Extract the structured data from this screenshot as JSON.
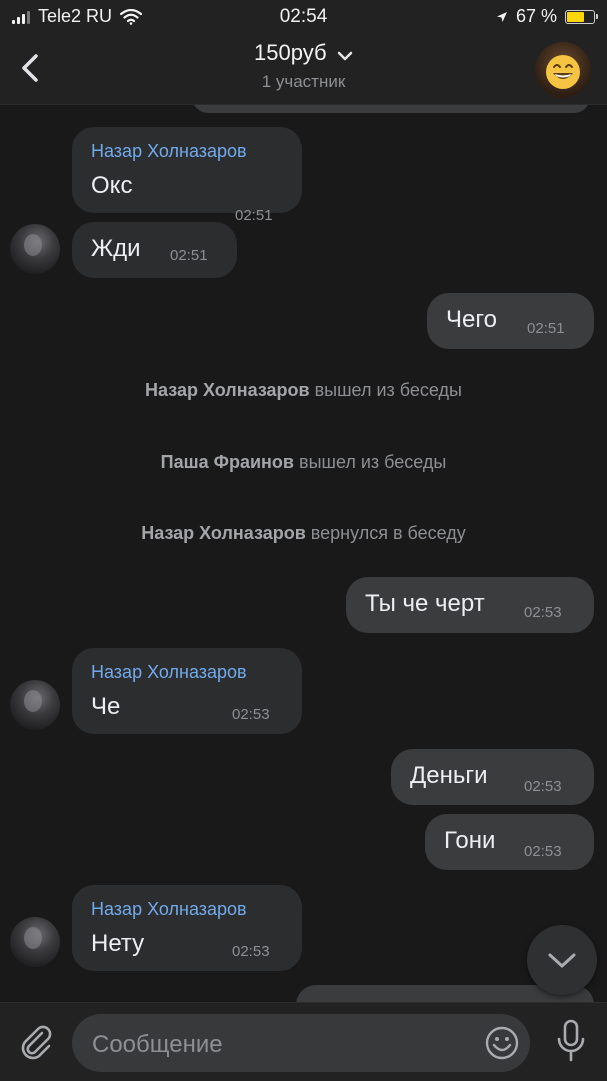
{
  "status_bar": {
    "carrier": "Tele2 RU",
    "time": "02:54",
    "battery_percent": "67 %",
    "battery_level": 0.67,
    "icons": [
      "signal-icon",
      "wifi-icon",
      "location-arrow-icon",
      "battery-icon"
    ]
  },
  "header": {
    "title": "150руб",
    "subtitle": "1 участник"
  },
  "messages": [
    {
      "sender": "Назар Холназаров",
      "text": "Окс",
      "time": "02:51"
    },
    {
      "text": "Жди",
      "time": "02:51"
    },
    {
      "text": "Чего",
      "time": "02:51"
    },
    {
      "text": "Ты че черт",
      "time": "02:53"
    },
    {
      "sender": "Назар Холназаров",
      "text": "Че",
      "time": "02:53"
    },
    {
      "text": "Деньги",
      "time": "02:53"
    },
    {
      "text": "Гони",
      "time": "02:53"
    },
    {
      "sender": "Назар Холназаров",
      "text": "Нету",
      "time": "02:53"
    }
  ],
  "service_messages": [
    {
      "name": "Назар Холназаров",
      "action": " вышел из беседы"
    },
    {
      "name": "Паша Фраинов",
      "action": " вышел из беседы"
    },
    {
      "name": "Назар Холназаров",
      "action": " вернулся в беседу"
    }
  ],
  "composer": {
    "placeholder": "Сообщение"
  },
  "colors": {
    "background": "#19191a",
    "incoming_bubble": "#2c2d2f",
    "outgoing_bubble": "#3b3c3e",
    "sender_name": "#71aaeb",
    "battery": "#ffd60a"
  }
}
